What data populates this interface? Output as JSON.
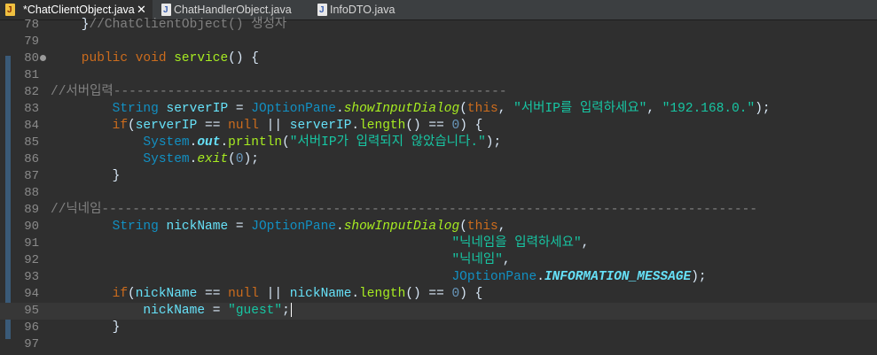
{
  "tabs": [
    {
      "label": "*ChatClientObject.java",
      "active": true,
      "close": "✕"
    },
    {
      "label": "ChatHandlerObject.java",
      "active": false
    },
    {
      "label": "InfoDTO.java",
      "active": false
    }
  ],
  "lines": [
    {
      "n": "78",
      "tokens": [
        [
          "def",
          "    }"
        ],
        [
          "cm",
          "//ChatClientObject() 생성자"
        ]
      ]
    },
    {
      "n": "79",
      "tokens": []
    },
    {
      "n": "80",
      "fold": true,
      "tokens": [
        [
          "kw",
          "    public void "
        ],
        [
          "fn",
          "service"
        ],
        [
          "def",
          "() {"
        ]
      ]
    },
    {
      "n": "81",
      "tokens": []
    },
    {
      "n": "82",
      "tokens": [
        [
          "cm",
          "//서버입력---------------------------------------------------"
        ]
      ]
    },
    {
      "n": "83",
      "tokens": [
        [
          "cls",
          "        String "
        ],
        [
          "fld",
          "serverIP"
        ],
        [
          "def",
          " = "
        ],
        [
          "cls",
          "JOptionPane"
        ],
        [
          "def",
          "."
        ],
        [
          "fn it",
          "showInputDialog"
        ],
        [
          "def",
          "("
        ],
        [
          "kw",
          "this"
        ],
        [
          "def",
          ", "
        ],
        [
          "str",
          "\"서버IP를 입력하세요\""
        ],
        [
          "def",
          ", "
        ],
        [
          "str",
          "\"192.168.0.\""
        ],
        [
          "def",
          ");"
        ]
      ]
    },
    {
      "n": "84",
      "tokens": [
        [
          "kw",
          "        if"
        ],
        [
          "def",
          "("
        ],
        [
          "fld",
          "serverIP"
        ],
        [
          "def",
          " == "
        ],
        [
          "kw",
          "null"
        ],
        [
          "def",
          " || "
        ],
        [
          "fld",
          "serverIP"
        ],
        [
          "def",
          "."
        ],
        [
          "fn",
          "length"
        ],
        [
          "def",
          "() == "
        ],
        [
          "num-lit",
          "0"
        ],
        [
          "def",
          ") {"
        ]
      ]
    },
    {
      "n": "85",
      "tokens": [
        [
          "cls",
          "            System"
        ],
        [
          "def",
          "."
        ],
        [
          "fld it b",
          "out"
        ],
        [
          "def",
          "."
        ],
        [
          "fn",
          "println"
        ],
        [
          "def",
          "("
        ],
        [
          "str",
          "\"서버IP가 입력되지 않았습니다.\""
        ],
        [
          "def",
          ");"
        ]
      ]
    },
    {
      "n": "86",
      "tokens": [
        [
          "cls",
          "            System"
        ],
        [
          "def",
          "."
        ],
        [
          "fn it",
          "exit"
        ],
        [
          "def",
          "("
        ],
        [
          "num-lit",
          "0"
        ],
        [
          "def",
          ");"
        ]
      ]
    },
    {
      "n": "87",
      "tokens": [
        [
          "def",
          "        }"
        ]
      ]
    },
    {
      "n": "88",
      "tokens": []
    },
    {
      "n": "89",
      "tokens": [
        [
          "cm",
          "//닉네임-------------------------------------------------------------------------------------"
        ]
      ]
    },
    {
      "n": "90",
      "tokens": [
        [
          "cls",
          "        String "
        ],
        [
          "fld",
          "nickName"
        ],
        [
          "def",
          " = "
        ],
        [
          "cls",
          "JOptionPane"
        ],
        [
          "def",
          "."
        ],
        [
          "fn it",
          "showInputDialog"
        ],
        [
          "def",
          "("
        ],
        [
          "kw",
          "this"
        ],
        [
          "def",
          ","
        ]
      ]
    },
    {
      "n": "91",
      "tokens": [
        [
          "def",
          "                                                    "
        ],
        [
          "str",
          "\"닉네임을 입력하세요\""
        ],
        [
          "def",
          ","
        ]
      ]
    },
    {
      "n": "92",
      "tokens": [
        [
          "def",
          "                                                    "
        ],
        [
          "str",
          "\"닉네임\""
        ],
        [
          "def",
          ","
        ]
      ]
    },
    {
      "n": "93",
      "tokens": [
        [
          "def",
          "                                                    "
        ],
        [
          "cls",
          "JOptionPane"
        ],
        [
          "def",
          "."
        ],
        [
          "fld it b",
          "INFORMATION_MESSAGE"
        ],
        [
          "def",
          ");"
        ]
      ]
    },
    {
      "n": "94",
      "tokens": [
        [
          "kw",
          "        if"
        ],
        [
          "def",
          "("
        ],
        [
          "fld",
          "nickName"
        ],
        [
          "def",
          " == "
        ],
        [
          "kw",
          "null"
        ],
        [
          "def",
          " || "
        ],
        [
          "fld",
          "nickName"
        ],
        [
          "def",
          "."
        ],
        [
          "fn",
          "length"
        ],
        [
          "def",
          "() == "
        ],
        [
          "num-lit",
          "0"
        ],
        [
          "def",
          ") {"
        ]
      ]
    },
    {
      "n": "95",
      "current": true,
      "tokens": [
        [
          "fld",
          "            nickName"
        ],
        [
          "def",
          " = "
        ],
        [
          "str",
          "\"guest\""
        ],
        [
          "def",
          ";"
        ]
      ]
    },
    {
      "n": "96",
      "tokens": [
        [
          "def",
          "        }"
        ]
      ]
    },
    {
      "n": "97",
      "tokens": []
    }
  ]
}
